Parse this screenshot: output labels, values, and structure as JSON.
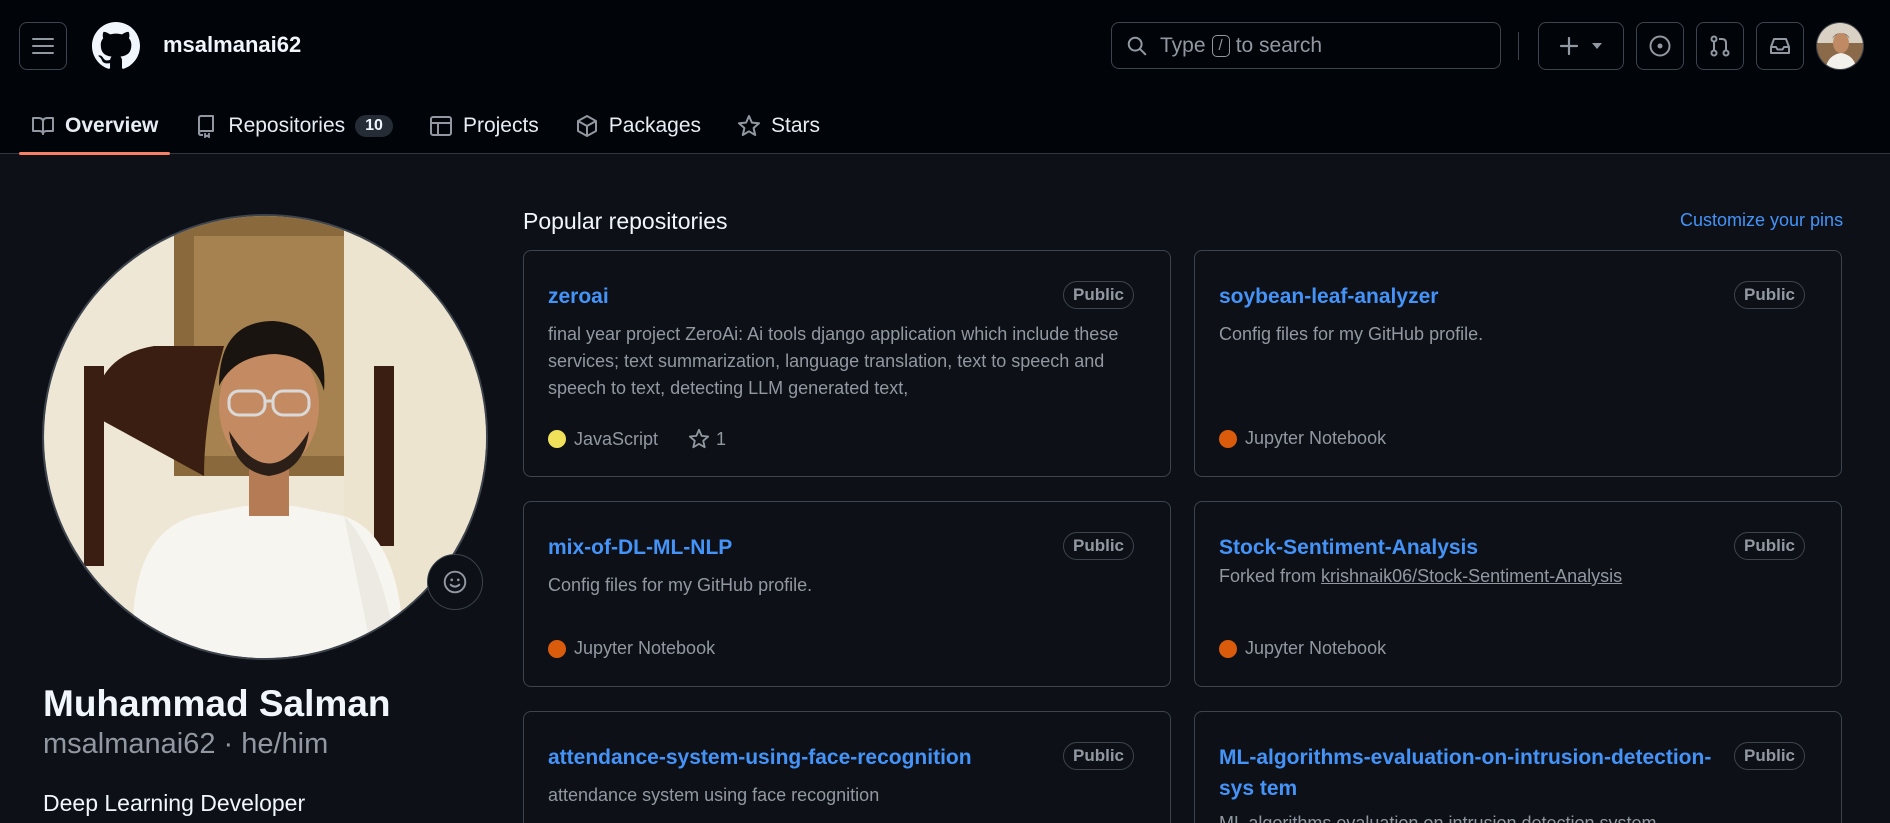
{
  "header": {
    "username": "msalmanai62",
    "search": {
      "prefix": "Type",
      "key": "/",
      "suffix": "to search"
    }
  },
  "tabs": [
    {
      "label": "Overview",
      "icon": "book-icon",
      "active": true
    },
    {
      "label": "Repositories",
      "icon": "repo-icon",
      "count": "10"
    },
    {
      "label": "Projects",
      "icon": "table-icon"
    },
    {
      "label": "Packages",
      "icon": "package-icon"
    },
    {
      "label": "Stars",
      "icon": "star-icon"
    }
  ],
  "profile": {
    "name": "Muhammad Salman",
    "handle": "msalmanai62 · he/him",
    "bio": "Deep Learning Developer"
  },
  "popular": {
    "title": "Popular repositories",
    "customize": "Customize your pins",
    "cards": [
      {
        "name": "zeroai",
        "visibility": "Public",
        "description": "final year project ZeroAi: Ai tools django application which include these services; text summarization, language translation, text to speech and speech to text, detecting LLM generated text,",
        "language": "JavaScript",
        "language_color": "#f1e05a",
        "stars": "1"
      },
      {
        "name": "soybean-leaf-analyzer",
        "visibility": "Public",
        "description": "Config files for my GitHub profile.",
        "language": "Jupyter Notebook",
        "language_color": "#DA5B0B"
      },
      {
        "name": "mix-of-DL-ML-NLP",
        "visibility": "Public",
        "description": "Config files for my GitHub profile.",
        "language": "Jupyter Notebook",
        "language_color": "#DA5B0B"
      },
      {
        "name": "Stock-Sentiment-Analysis",
        "visibility": "Public",
        "forked_prefix": "Forked from",
        "forked_from": "krishnaik06/Stock-Sentiment-Analysis",
        "language": "Jupyter Notebook",
        "language_color": "#DA5B0B"
      },
      {
        "name": "attendance-system-using-face-recognition",
        "visibility": "Public",
        "description": "attendance system using face recognition"
      },
      {
        "name": "ML-algorithms-evaluation-on-intrusion-detection-sys tem",
        "visibility": "Public",
        "description": "ML algorithms evaluation on intrusion detection system"
      }
    ]
  }
}
